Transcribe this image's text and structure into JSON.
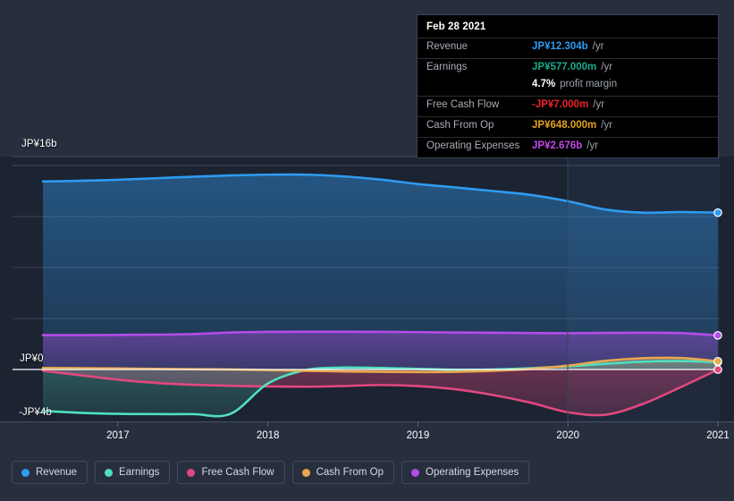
{
  "tooltip": {
    "title": "Feb 28 2021",
    "rows": [
      {
        "label": "Revenue",
        "value": "JP¥12.304b",
        "unit": "/yr",
        "color": "#2f9bf0"
      },
      {
        "label": "Earnings",
        "value": "JP¥577.000m",
        "unit": "/yr",
        "color": "#1ba98c"
      },
      {
        "label": "",
        "value": "4.7%",
        "unit": "profit margin",
        "color": "#ffffff"
      },
      {
        "label": "Free Cash Flow",
        "value": "-JP¥7.000m",
        "unit": "/yr",
        "color": "#f0232d"
      },
      {
        "label": "Cash From Op",
        "value": "JP¥648.000m",
        "unit": "/yr",
        "color": "#e0a020"
      },
      {
        "label": "Operating Expenses",
        "value": "JP¥2.676b",
        "unit": "/yr",
        "color": "#c04ae8"
      }
    ]
  },
  "legend": {
    "items": [
      {
        "label": "Revenue",
        "color": "#2f9bf0"
      },
      {
        "label": "Earnings",
        "color": "#4fe0c0"
      },
      {
        "label": "Free Cash Flow",
        "color": "#e0487f"
      },
      {
        "label": "Cash From Op",
        "color": "#e8a84f"
      },
      {
        "label": "Operating Expenses",
        "color": "#b44ce8"
      }
    ]
  },
  "axes": {
    "y_top_label": "JP¥16b",
    "y_zero_label": "JP¥0",
    "y_bottom_label": "-JP¥4b",
    "x_ticks": [
      "2017",
      "2018",
      "2019",
      "2020",
      "2021"
    ]
  },
  "chart_data": {
    "type": "area",
    "title": "",
    "xlabel": "",
    "ylabel": "JP¥",
    "ylim": [
      -4,
      16
    ],
    "grid": true,
    "legend_position": "bottom",
    "x_tick_labels": [
      "2017",
      "2018",
      "2019",
      "2020",
      "2021"
    ],
    "x": [
      "2016-08",
      "2016-11",
      "2017-02",
      "2017-05",
      "2017-08",
      "2017-11",
      "2018-02",
      "2018-05",
      "2018-08",
      "2018-11",
      "2019-02",
      "2019-05",
      "2019-08",
      "2019-11",
      "2020-02",
      "2020-05",
      "2020-08",
      "2020-11",
      "2021-02"
    ],
    "series": [
      {
        "name": "Revenue",
        "color": "#2f9bf0",
        "values": [
          14.75,
          14.8,
          14.88,
          15.0,
          15.12,
          15.22,
          15.28,
          15.28,
          15.15,
          14.9,
          14.55,
          14.28,
          14.0,
          13.7,
          13.2,
          12.55,
          12.3,
          12.35,
          12.304
        ]
      },
      {
        "name": "Earnings",
        "color": "#4fe0c0",
        "values": [
          -3.25,
          -3.4,
          -3.48,
          -3.5,
          -3.5,
          -3.48,
          -1.1,
          -0.05,
          0.15,
          0.12,
          0.05,
          -0.02,
          0.0,
          0.1,
          0.25,
          0.45,
          0.62,
          0.66,
          0.577
        ]
      },
      {
        "name": "Free Cash Flow",
        "color": "#e0487f",
        "values": [
          -0.1,
          -0.45,
          -0.8,
          -1.05,
          -1.2,
          -1.28,
          -1.33,
          -1.35,
          -1.3,
          -1.22,
          -1.3,
          -1.55,
          -2.0,
          -2.6,
          -3.35,
          -3.55,
          -2.7,
          -1.4,
          -0.007
        ]
      },
      {
        "name": "Cash From Op",
        "color": "#e8a84f",
        "values": [
          0.12,
          0.1,
          0.08,
          0.05,
          0.02,
          0.0,
          -0.05,
          -0.1,
          -0.15,
          -0.18,
          -0.2,
          -0.18,
          -0.1,
          0.05,
          0.3,
          0.68,
          0.88,
          0.9,
          0.648
        ]
      },
      {
        "name": "Operating Expenses",
        "color": "#b44ce8",
        "values": [
          2.7,
          2.7,
          2.71,
          2.73,
          2.78,
          2.9,
          2.95,
          2.96,
          2.96,
          2.95,
          2.93,
          2.9,
          2.88,
          2.86,
          2.85,
          2.87,
          2.88,
          2.86,
          2.676
        ]
      }
    ]
  }
}
